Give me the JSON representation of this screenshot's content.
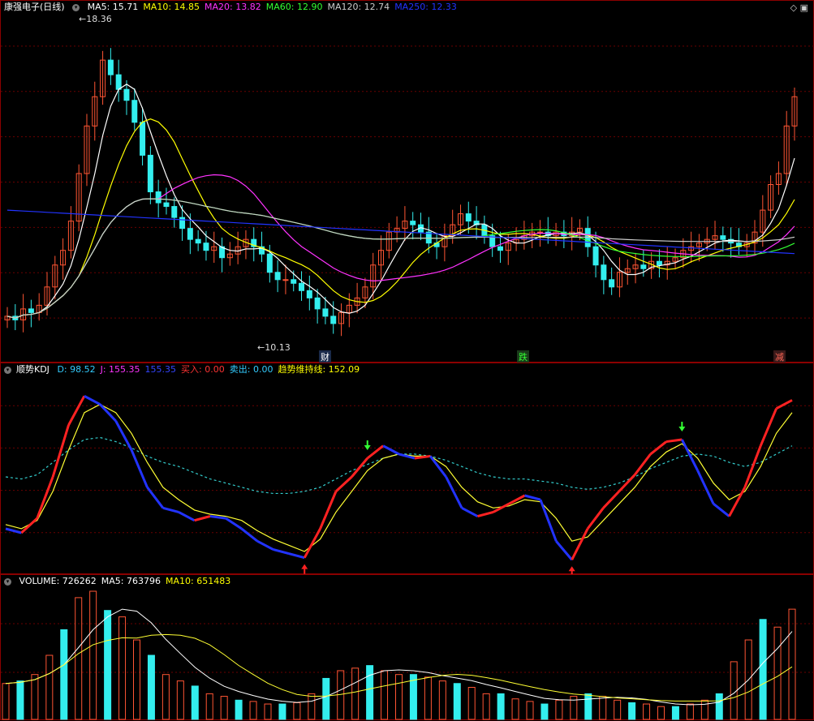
{
  "main": {
    "stock": "康强电子",
    "period": "(日线)",
    "ma": [
      {
        "label": "MA5: 15.71",
        "color": "#ffffff"
      },
      {
        "label": "MA10: 14.85",
        "color": "#ffff00"
      },
      {
        "label": "MA20: 13.82",
        "color": "#ff33ff"
      },
      {
        "label": "MA60: 12.90",
        "color": "#33ff33"
      },
      {
        "label": "MA120: 12.74",
        "color": "#cccccc"
      },
      {
        "label": "MA250: 12.33",
        "color": "#2233ff"
      }
    ],
    "high_label": "18.36",
    "low_label": "10.13",
    "events": [
      {
        "text": "财",
        "color": "#3399ff"
      },
      {
        "text": "跌",
        "color": "#33ff33"
      },
      {
        "text": "减",
        "color": "#ff3333"
      }
    ]
  },
  "kdj": {
    "name": "顺势KDJ",
    "items": [
      {
        "label": "D: 98.52",
        "color": "#33ccff"
      },
      {
        "label": "J: 155.35",
        "color": "#ff33ff"
      },
      {
        "label": "155.35",
        "color": "#3344ff"
      },
      {
        "label": "买入: 0.00",
        "color": "#ff3333"
      },
      {
        "label": "卖出: 0.00",
        "color": "#33ccff"
      },
      {
        "label": "趋势维持线: 152.09",
        "color": "#ffff00"
      }
    ]
  },
  "volume": {
    "items": [
      {
        "label": "VOLUME: 726262",
        "color": "#ffffff"
      },
      {
        "label": "MA5: 763796",
        "color": "#ffffff"
      },
      {
        "label": "MA10: 651483",
        "color": "#ffff00"
      }
    ]
  },
  "colors": {
    "up": "#ff5533",
    "down": "#33eeee",
    "grid": "#8b0000"
  },
  "chart_data": [
    {
      "type": "candlestick",
      "title": "康强电子 (日线)",
      "ylim": [
        10.13,
        18.36
      ],
      "series_names": [
        "MA5",
        "MA10",
        "MA20",
        "MA60",
        "MA120",
        "MA250"
      ],
      "close": [
        10.6,
        10.5,
        10.8,
        10.7,
        10.9,
        11.4,
        12.0,
        12.4,
        13.2,
        14.5,
        15.8,
        16.6,
        17.6,
        17.2,
        16.8,
        16.5,
        15.9,
        15.0,
        14.0,
        13.7,
        13.6,
        13.3,
        13.0,
        12.7,
        12.6,
        12.4,
        12.5,
        12.2,
        12.3,
        12.5,
        12.7,
        12.5,
        12.3,
        11.8,
        11.6,
        11.6,
        11.5,
        11.3,
        11.1,
        10.8,
        10.6,
        10.4,
        10.7,
        10.9,
        11.1,
        11.4,
        12.0,
        12.4,
        12.9,
        13.0,
        13.2,
        13.1,
        12.9,
        12.6,
        12.5,
        12.8,
        13.1,
        13.4,
        13.2,
        13.1,
        12.8,
        12.5,
        12.4,
        12.6,
        12.7,
        12.8,
        12.9,
        12.9,
        12.8,
        12.9,
        12.8,
        12.9,
        13.0,
        12.5,
        12.0,
        11.6,
        11.4,
        11.8,
        11.9,
        12.0,
        11.9,
        12.1,
        12.0,
        12.1,
        12.2,
        12.4,
        12.5,
        12.6,
        12.7,
        12.8,
        12.7,
        12.6,
        12.5,
        12.6,
        12.9,
        13.5,
        14.2,
        14.5,
        15.8,
        16.6
      ]
    },
    {
      "type": "line",
      "title": "顺势KDJ",
      "series": [
        {
          "name": "K",
          "values": [
            20,
            18,
            25,
            45,
            70,
            84,
            80,
            72,
            58,
            40,
            30,
            28,
            24,
            26,
            25,
            20,
            14,
            10,
            8,
            6,
            20,
            38,
            45,
            54,
            60,
            56,
            54,
            55,
            45,
            30,
            26,
            28,
            32,
            36,
            34,
            14,
            5,
            20,
            30,
            38,
            46,
            56,
            62,
            63,
            48,
            32,
            26,
            40,
            60,
            78,
            82
          ]
        },
        {
          "name": "D",
          "values": [
            22,
            20,
            24,
            38,
            58,
            76,
            80,
            76,
            66,
            52,
            40,
            34,
            29,
            27,
            26,
            24,
            19,
            15,
            12,
            9,
            15,
            28,
            38,
            48,
            54,
            56,
            55,
            55,
            50,
            40,
            33,
            30,
            31,
            34,
            33,
            25,
            14,
            16,
            24,
            32,
            40,
            50,
            57,
            61,
            54,
            42,
            34,
            38,
            50,
            66,
            76
          ]
        },
        {
          "name": "趋势维持线",
          "values": [
            45,
            44,
            46,
            52,
            58,
            63,
            64,
            62,
            59,
            55,
            52,
            50,
            47,
            44,
            42,
            40,
            38,
            37,
            37,
            38,
            40,
            44,
            48,
            51,
            54,
            56,
            56,
            55,
            53,
            50,
            47,
            45,
            44,
            44,
            43,
            42,
            40,
            39,
            40,
            42,
            45,
            49,
            52,
            55,
            56,
            55,
            52,
            50,
            52,
            56,
            60
          ]
        }
      ]
    },
    {
      "type": "bar",
      "title": "VOLUME",
      "series_names": [
        "VOLUME",
        "MA5",
        "MA10"
      ],
      "values": [
        0.28,
        0.3,
        0.35,
        0.5,
        0.7,
        0.95,
        1.0,
        0.85,
        0.8,
        0.62,
        0.5,
        0.35,
        0.3,
        0.26,
        0.2,
        0.18,
        0.15,
        0.14,
        0.12,
        0.12,
        0.13,
        0.2,
        0.32,
        0.38,
        0.4,
        0.42,
        0.38,
        0.35,
        0.35,
        0.33,
        0.3,
        0.28,
        0.25,
        0.2,
        0.2,
        0.16,
        0.14,
        0.12,
        0.15,
        0.18,
        0.2,
        0.18,
        0.15,
        0.13,
        0.12,
        0.1,
        0.1,
        0.12,
        0.15,
        0.2,
        0.45,
        0.62,
        0.78,
        0.72,
        0.86
      ]
    }
  ]
}
